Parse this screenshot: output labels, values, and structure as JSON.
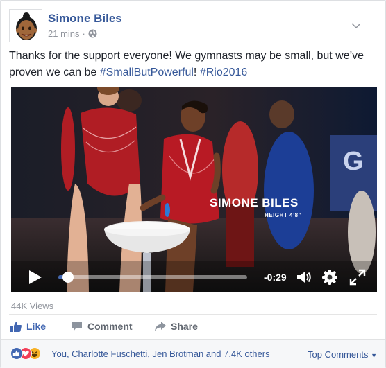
{
  "post": {
    "author": "Simone Biles",
    "timestamp": "21 mins",
    "separator": "·",
    "privacy_icon": "globe-icon",
    "text_before": "Thanks for the support everyone! We gymnasts may be small, but we’ve proven we can be ",
    "hashtag1": "#SmallButPowerful",
    "text_between": "! ",
    "hashtag2": "#Rio2016"
  },
  "video": {
    "overlay_name": "SIMONE BILES",
    "overlay_height": "HEIGHT 4’8”",
    "time_remaining": "-0:29",
    "progress": 0.05
  },
  "stats": {
    "views": "44K Views"
  },
  "actions": {
    "like": "Like",
    "comment": "Comment",
    "share": "Share"
  },
  "reactions": {
    "types": [
      "like",
      "love",
      "haha"
    ],
    "summary": "You, Charlotte Fuschetti, Jen Brotman and 7.4K others",
    "top_comments": "Top Comments"
  },
  "colors": {
    "brand": "#365899",
    "accent": "#4267b2",
    "love": "#f33e58",
    "haha": "#f7b125"
  }
}
